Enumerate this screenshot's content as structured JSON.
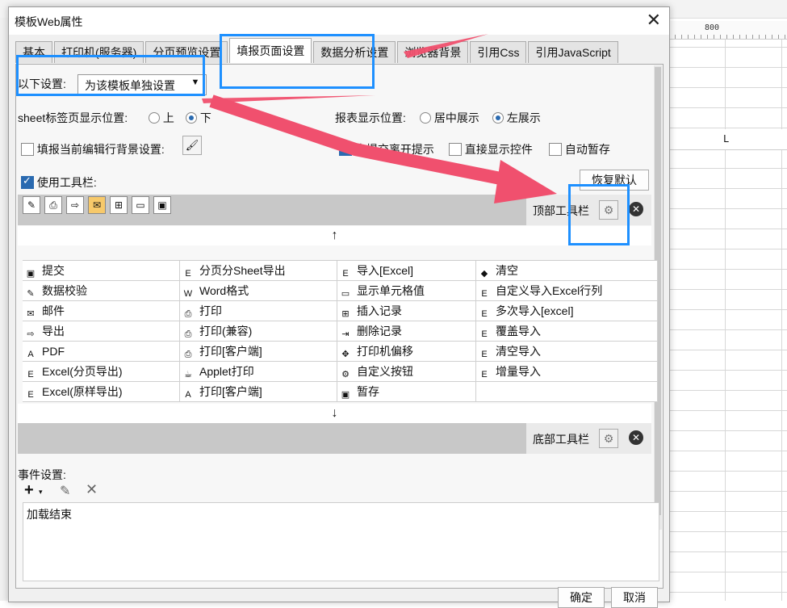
{
  "dialog": {
    "title": "模板Web属性",
    "tabs": [
      {
        "label": "基本",
        "active": false
      },
      {
        "label": "打印机(服务器)",
        "active": false
      },
      {
        "label": "分页预览设置",
        "active": false
      },
      {
        "label": "填报页面设置",
        "active": true
      },
      {
        "label": "数据分析设置",
        "active": false
      },
      {
        "label": "浏览器背景",
        "active": false
      },
      {
        "label": "引用Css",
        "active": false
      },
      {
        "label": "引用JavaScript",
        "active": false
      }
    ],
    "ok_label": "确定",
    "cancel_label": "取消"
  },
  "settings": {
    "scope_label": "以下设置:",
    "scope_value": "为该模板单独设置",
    "sheet_pos_label": "sheet标签页显示位置:",
    "sheet_pos_options": [
      "上",
      "下"
    ],
    "sheet_pos_selected": "下",
    "report_pos_label": "报表显示位置:",
    "report_pos_options": [
      "居中展示",
      "左展示"
    ],
    "report_pos_selected": "左展示",
    "fill_bg_label": "填报当前编辑行背景设置:",
    "fill_bg_checked": false,
    "unsubmitted_label": "未提交离开提示",
    "unsubmitted_checked": true,
    "direct_show_label": "直接显示控件",
    "direct_show_checked": false,
    "autosave_label": "自动暂存",
    "autosave_checked": false,
    "use_toolbar_label": "使用工具栏:",
    "use_toolbar_checked": true,
    "restore_label": "恢复默认"
  },
  "toolbar": {
    "top_label": "顶部工具栏",
    "bottom_label": "底部工具栏",
    "top_icons": [
      "validate-icon",
      "print-icon",
      "export-icon",
      "mail-icon",
      "insert-record-icon",
      "show-cell-icon",
      "save-icon"
    ],
    "up_arrow": "↑",
    "down_arrow": "↓",
    "grid": [
      [
        "提交",
        "分页分Sheet导出",
        "导入[Excel]",
        "清空"
      ],
      [
        "数据校验",
        "Word格式",
        "显示单元格值",
        "自定义导入Excel行列"
      ],
      [
        "邮件",
        "打印",
        "插入记录",
        "多次导入[excel]"
      ],
      [
        "导出",
        "打印(兼容)",
        "删除记录",
        "覆盖导入"
      ],
      [
        "PDF",
        "打印[客户端]",
        "打印机偏移",
        "清空导入"
      ],
      [
        "Excel(分页导出)",
        "Applet打印",
        "自定义按钮",
        "增量导入"
      ],
      [
        "Excel(原样导出)",
        "打印[客户端]",
        "暂存",
        ""
      ]
    ]
  },
  "events": {
    "label": "事件设置:",
    "items": [
      "加载结束"
    ]
  },
  "background": {
    "ruler_label": "800",
    "column_label": "L"
  },
  "colors": {
    "highlight_blue": "#1e90ff",
    "arrow_red": "#f0506e"
  }
}
